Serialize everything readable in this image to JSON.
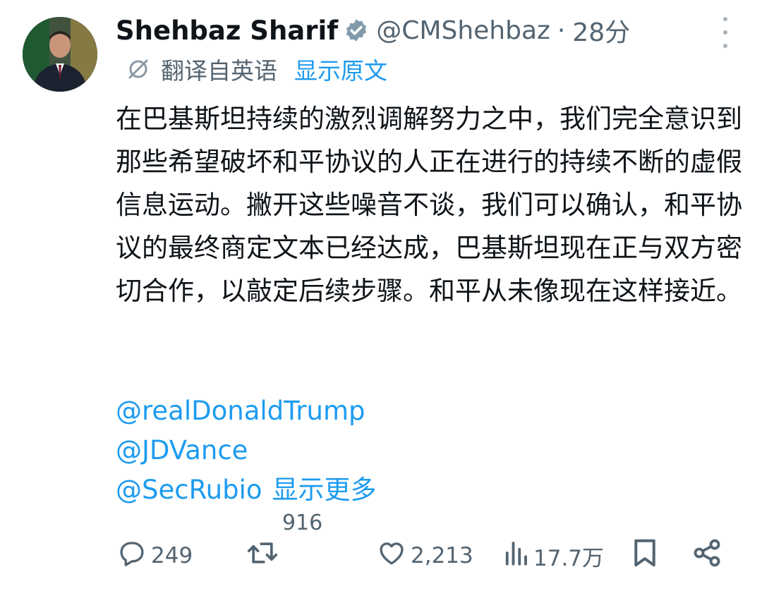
{
  "author": {
    "name": "Shehbaz Sharif",
    "handle": "@CMShehbaz",
    "separator": "·",
    "time": "28分"
  },
  "icons": {
    "verified": "verified-badge-icon",
    "more": "more-vertical-icon",
    "translate": "translate-icon",
    "reply": "reply-icon",
    "repost": "repost-icon",
    "like": "like-icon",
    "views": "views-icon",
    "bookmark": "bookmark-icon",
    "share": "share-icon"
  },
  "translation": {
    "label": "翻译自英语",
    "show_original": "显示原文"
  },
  "tweet": {
    "text": "在巴基斯坦持续的激烈调解努力之中，我们完全意识到那些希望破坏和平协议的人正在进行的持续不断的虚假信息运动。撇开这些噪音不谈，我们可以确认，和平协议的最终商定文本已经达成，巴基斯坦现在正与双方密切合作，以敲定后续步骤。和平从未像现在这样接近。",
    "mentions": [
      "@realDonaldTrump",
      "@JDVance",
      "@SecRubio"
    ],
    "show_more": "显示更多"
  },
  "actions": {
    "reply_count": "249",
    "repost_count": "916",
    "like_count": "2,213",
    "view_count": "17.7万"
  },
  "colors": {
    "text": "#0f1419",
    "secondary": "#536471",
    "link": "#1d9bf0",
    "verified_badge": "#829aab"
  }
}
